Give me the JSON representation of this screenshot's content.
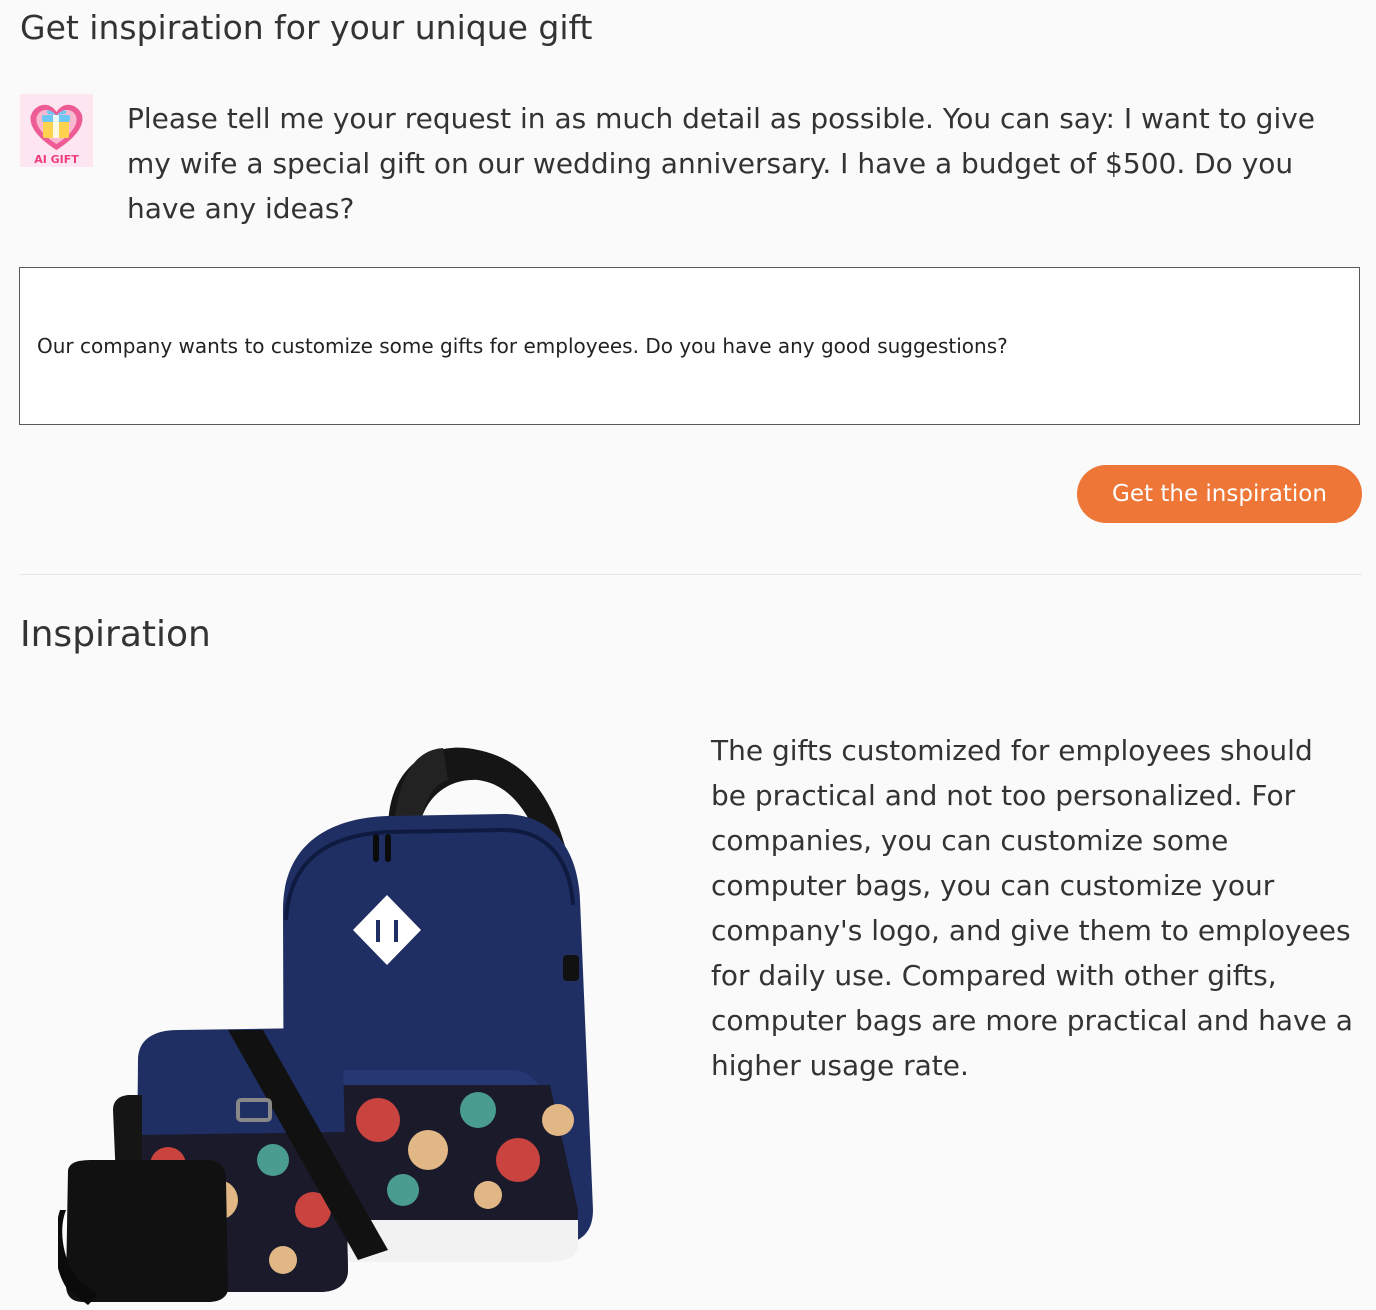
{
  "header": {
    "title": "Get inspiration for your unique gift"
  },
  "assistant": {
    "logo_text": "AI GIFT",
    "prompt": "Please tell me your request in as much detail as possible. You can say: I want to give my wife a special gift on our wedding anniversary. I have a budget of $500. Do you have any ideas?"
  },
  "request": {
    "value": "Our company wants to customize some gifts for employees. Do you have any good suggestions?"
  },
  "actions": {
    "get_inspiration_label": "Get the inspiration"
  },
  "inspiration": {
    "title": "Inspiration",
    "answer": "The gifts customized for employees should be practical and not too personalized. For companies, you can customize some computer bags, you can customize your company's logo, and give them to employees for daily use. Compared with other gifts, computer bags are more practical and have a higher usage rate."
  },
  "colors": {
    "accent": "#ee7636",
    "text": "#333333",
    "background": "#fafafa",
    "bag_navy": "#1f2f63"
  },
  "icons": {
    "logo": "heart-gift-icon"
  }
}
